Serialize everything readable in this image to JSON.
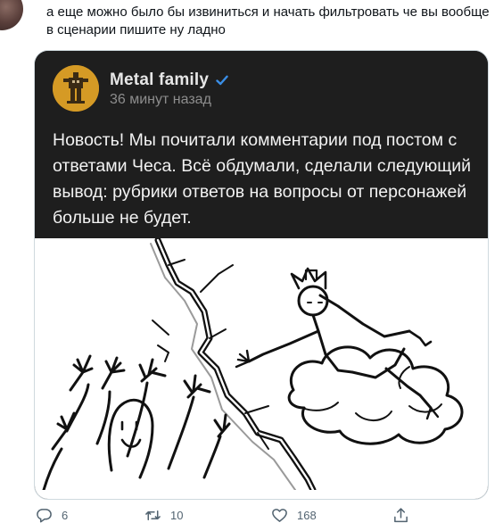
{
  "tweet": {
    "text": "а еще можно было бы извиниться и начать фильтровать че вы вообще в сценарии пишите ну ладно"
  },
  "embedded_post": {
    "author": "Metal family",
    "time": "36 минут назад",
    "body": "Новость! Мы почитали комментарии под постом с ответами Чеса. Всё обдумали, сделали следующий вывод: рубрики ответов на вопросы от персонажей больше не будет."
  },
  "actions": {
    "replies": "6",
    "retweets": "10",
    "likes": "168"
  },
  "colors": {
    "card_bg": "#1e1e1e",
    "verified": "#3a8ee6",
    "muted": "#536471"
  },
  "icons": [
    "verified-icon",
    "reply-icon",
    "retweet-icon",
    "like-icon",
    "share-icon"
  ]
}
